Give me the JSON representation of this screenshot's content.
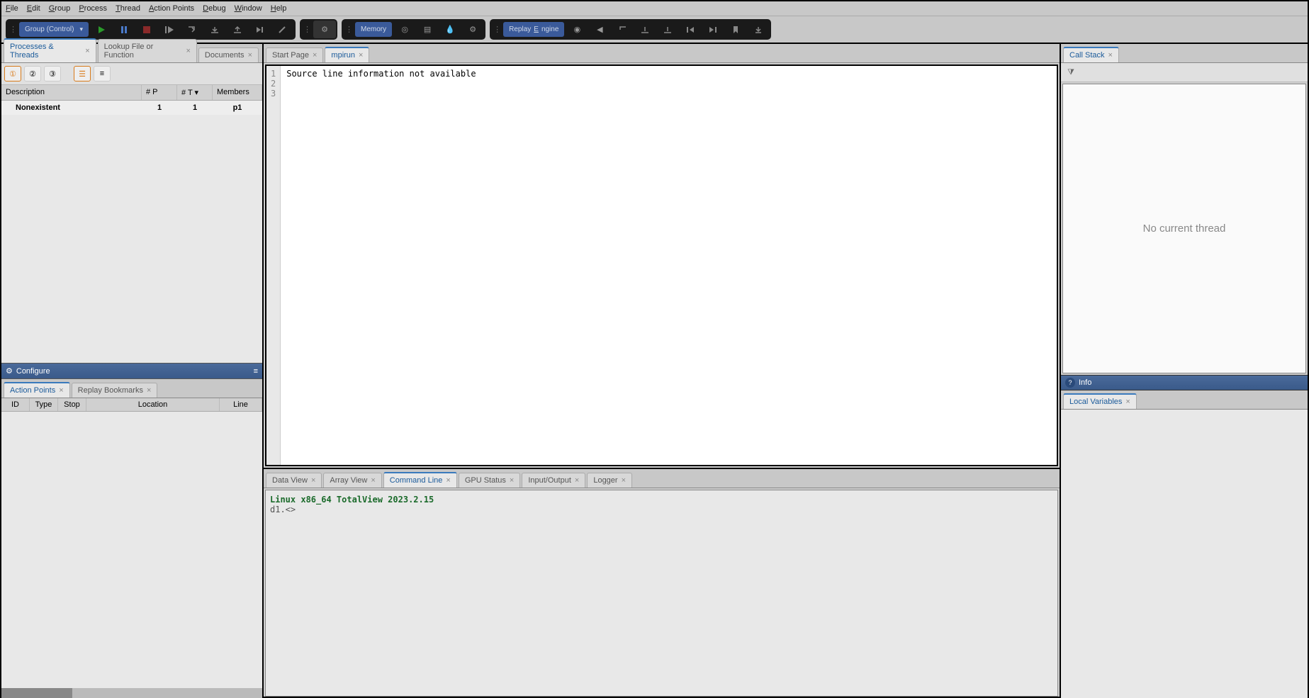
{
  "menu": {
    "file": "File",
    "edit": "Edit",
    "group": "Group",
    "process": "Process",
    "thread": "Thread",
    "action_points": "Action Points",
    "debug": "Debug",
    "window": "Window",
    "help": "Help"
  },
  "toolbar": {
    "group_label": "Group (Control)",
    "memory_label": "Memory",
    "replay_label": "ReplayEngine"
  },
  "left_tabs": {
    "processes": "Processes & Threads",
    "lookup": "Lookup File or Function",
    "documents": "Documents"
  },
  "pt_headers": {
    "desc": "Description",
    "p": "# P",
    "t": "# T",
    "members": "Members"
  },
  "pt_row": {
    "desc": "Nonexistent",
    "p": "1",
    "t": "1",
    "members": "p1"
  },
  "configure_label": "Configure",
  "ap_tabs": {
    "action_points": "Action Points",
    "replay_bookmarks": "Replay Bookmarks"
  },
  "ap_headers": {
    "id": "ID",
    "type": "Type",
    "stop": "Stop",
    "location": "Location",
    "line": "Line"
  },
  "source_tabs": {
    "start": "Start Page",
    "mpirun": "mpirun"
  },
  "source": {
    "lines": [
      "1",
      "2",
      "3"
    ],
    "text": "Source line information not available"
  },
  "bottom_tabs": {
    "data_view": "Data View",
    "array_view": "Array View",
    "command_line": "Command Line",
    "gpu_status": "GPU Status",
    "input_output": "Input/Output",
    "logger": "Logger"
  },
  "command": {
    "version": "Linux x86_64 TotalView 2023.2.15",
    "prompt": "d1.<>"
  },
  "right_tabs": {
    "call_stack": "Call Stack",
    "local_vars": "Local Variables"
  },
  "call_stack_msg": "No current thread",
  "info_label": "Info"
}
